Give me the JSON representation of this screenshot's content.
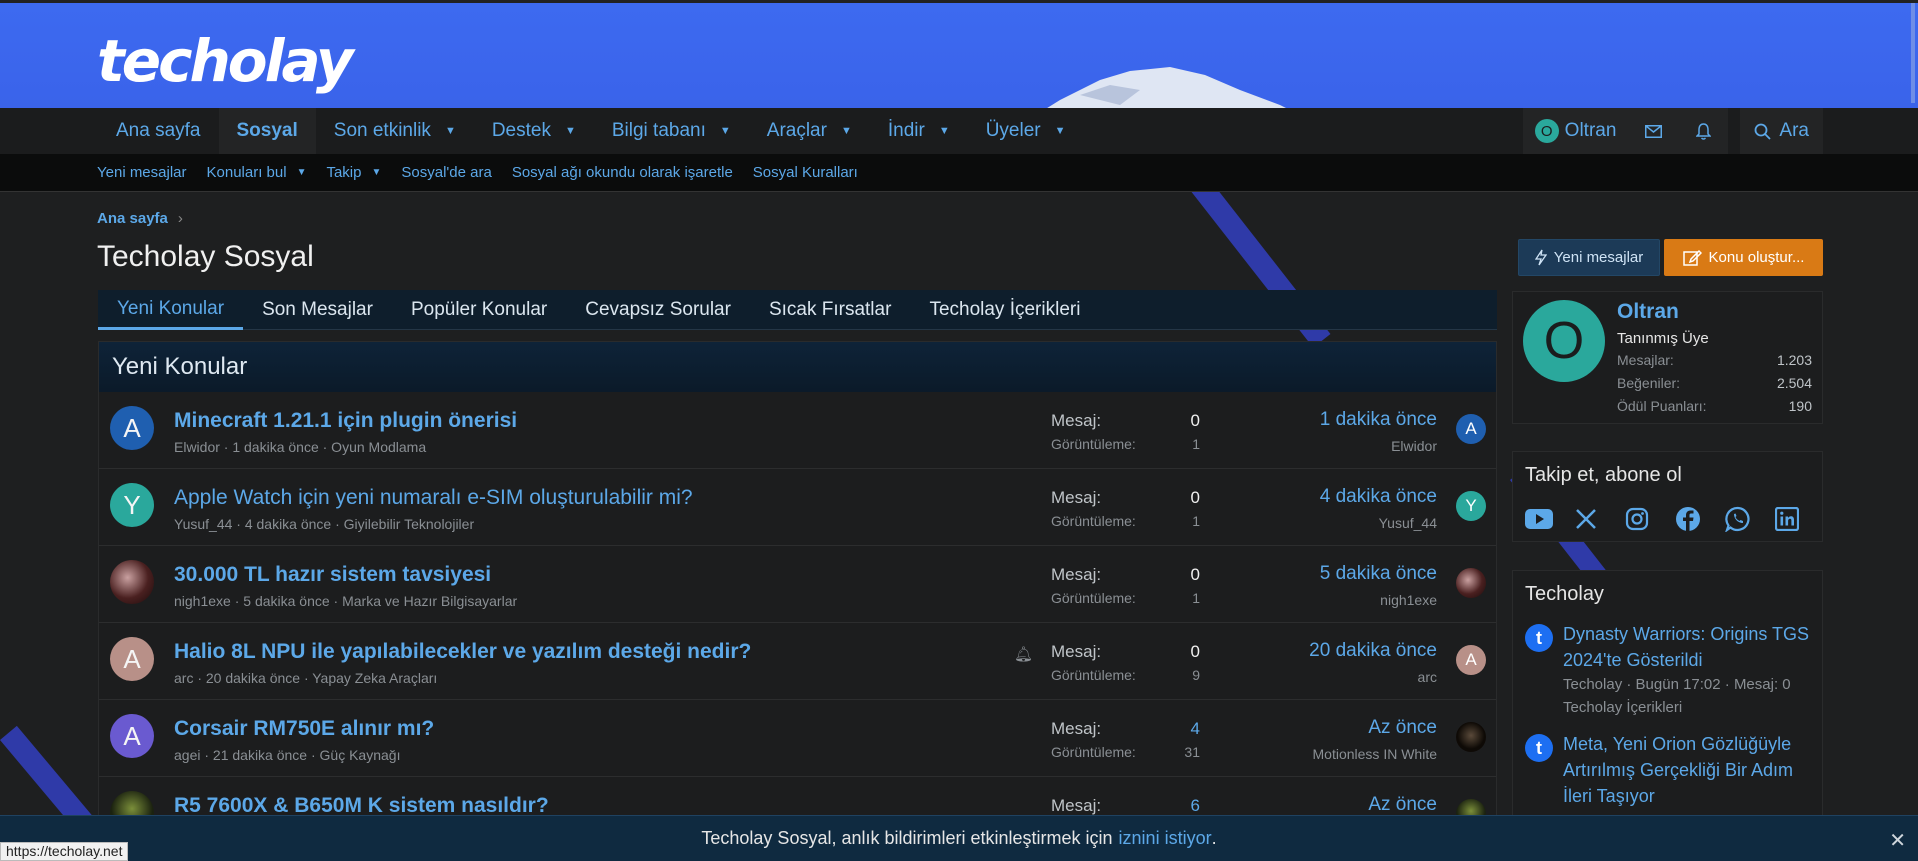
{
  "header": {
    "logo": "techolay"
  },
  "mainnav": {
    "tabs": [
      {
        "label": "Ana sayfa",
        "caret": false
      },
      {
        "label": "Sosyal",
        "caret": false,
        "active": true
      },
      {
        "label": "Son etkinlik",
        "caret": true
      },
      {
        "label": "Destek",
        "caret": true
      },
      {
        "label": "Bilgi tabanı",
        "caret": true
      },
      {
        "label": "Araçlar",
        "caret": true
      },
      {
        "label": "İndir",
        "caret": true
      },
      {
        "label": "Üyeler",
        "caret": true
      }
    ],
    "user": {
      "initial": "O",
      "name": "Oltran"
    },
    "search_label": "Ara"
  },
  "subnav": {
    "items": [
      {
        "label": "Yeni mesajlar",
        "caret": false
      },
      {
        "label": "Konuları bul",
        "caret": true
      },
      {
        "label": "Takip",
        "caret": true
      },
      {
        "label": "Sosyal'de ara",
        "caret": false
      },
      {
        "label": "Sosyal ağı okundu olarak işaretle",
        "caret": false
      },
      {
        "label": "Sosyal Kuralları",
        "caret": false
      }
    ]
  },
  "breadcrumb": {
    "label": "Ana sayfa"
  },
  "page": {
    "title": "Techolay Sosyal",
    "new_posts_button": "Yeni mesajlar",
    "create_thread_button": "Konu oluştur..."
  },
  "content_tabs": [
    "Yeni Konular",
    "Son Mesajlar",
    "Popüler Konular",
    "Cevapsız Sorular",
    "Sıcak Fırsatlar",
    "Techolay İçerikleri"
  ],
  "threads": {
    "heading": "Yeni Konular",
    "msg_label": "Mesaj:",
    "views_label": "Görüntüleme:",
    "rows": [
      {
        "initial": "A",
        "avatar_color": "#1f5fb0",
        "title": "Minecraft 1.21.1 için plugin önerisi",
        "meta": "Elwidor · 1 dakika önce · Oyun Modlama",
        "messages": "0",
        "views": "1",
        "when": "1 dakika önce",
        "last_user": "Elwidor",
        "last_initial": "A",
        "last_color": "#1f5fb0"
      },
      {
        "initial": "Y",
        "avatar_color": "#2aa89c",
        "title": "Apple Watch için yeni numaralı e-SIM oluşturulabilir mi?",
        "meta": "Yusuf_44 · 4 dakika önce · Giyilebilir Teknolojiler",
        "messages": "0",
        "views": "1",
        "when": "4 dakika önce",
        "last_user": "Yusuf_44",
        "last_initial": "Y",
        "last_color": "#2aa89c"
      },
      {
        "initial": "",
        "avatar_color": "",
        "title": "30.000 TL hazır sistem tavsiyesi",
        "meta": "nigh1exe · 5 dakika önce · Marka ve Hazır Bilgisayarlar",
        "messages": "0",
        "views": "1",
        "when": "5 dakika önce",
        "last_user": "nigh1exe",
        "last_initial": "",
        "last_color": ""
      },
      {
        "initial": "A",
        "avatar_color": "#b89088",
        "title": "Halio 8L NPU ile yapılabilecekler ve yazılım desteği nedir?",
        "meta": "arc · 20 dakika önce · Yapay Zeka Araçları",
        "messages": "0",
        "views": "9",
        "when": "20 dakika önce",
        "last_user": "arc",
        "last_initial": "A",
        "last_color": "#b89088"
      },
      {
        "initial": "A",
        "avatar_color": "#6a5ad0",
        "title": "Corsair RM750E alınır mı?",
        "meta": "agei · 21 dakika önce · Güç Kaynağı",
        "messages": "4",
        "views": "31",
        "when": "Az önce",
        "last_user": "Motionless IN White",
        "last_initial": "",
        "last_color": ""
      },
      {
        "initial": "",
        "avatar_color": "",
        "title": "R5 7600X & B650M K sistem nasıldır?",
        "meta": "",
        "messages": "6",
        "views": "",
        "when": "Az önce",
        "last_user": "",
        "last_initial": "",
        "last_color": ""
      }
    ]
  },
  "profile": {
    "initial": "O",
    "name": "Oltran",
    "rank": "Tanınmış Üye",
    "stats": [
      {
        "label": "Mesajlar:",
        "value": "1.203"
      },
      {
        "label": "Beğeniler:",
        "value": "2.504"
      },
      {
        "label": "Ödül Puanları:",
        "value": "190"
      }
    ]
  },
  "social": {
    "title": "Takip et, abone ol",
    "icons": [
      "youtube-icon",
      "x-icon",
      "instagram-icon",
      "facebook-icon",
      "whatsapp-icon",
      "linkedin-icon"
    ]
  },
  "news": {
    "title": "Techolay",
    "items": [
      {
        "title": "Dynasty Warriors: Origins TGS 2024'te Gösterildi",
        "meta": "Techolay · Bugün 17:02 · Mesaj: 0",
        "category": "Techolay İçerikleri"
      },
      {
        "title": "Meta, Yeni Orion Gözlüğüyle Artırılmış Gerçekliği Bir Adım İleri Taşıyor",
        "meta": "",
        "category": ""
      }
    ]
  },
  "notification": {
    "text": "Techolay Sosyal, anlık bildirimleri etkinleştirmek için",
    "link": "iznini istiyor",
    "end": "."
  },
  "status_url": "https://techolay.net",
  "colors": {
    "accent": "#5ca8e8",
    "header_blue": "#3d6af0",
    "create_button": "#d97a15",
    "stripe": "#2f3aa8"
  }
}
